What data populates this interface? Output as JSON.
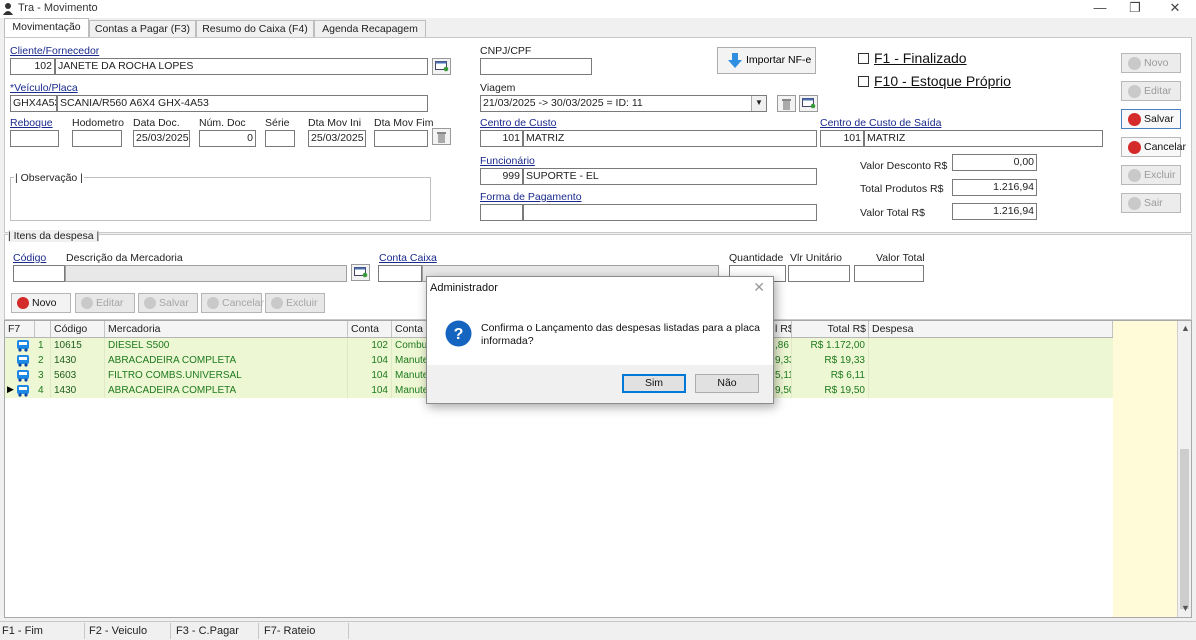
{
  "window": {
    "title": "Tra - Movimento",
    "controls": {
      "minimize": "—",
      "restore": "❐",
      "close": "✕"
    }
  },
  "tabs": [
    {
      "label": "Movimentação",
      "active": true
    },
    {
      "label": "Contas a Pagar (F3)"
    },
    {
      "label": "Resumo do Caixa (F4)"
    },
    {
      "label": "Agenda Recapagem"
    }
  ],
  "form": {
    "cliente_label": "Cliente/Fornecedor",
    "cliente_code": "102",
    "cliente_name": "JANETE DA ROCHA LOPES",
    "cnpj_label": "CNPJ/CPF",
    "cnpj_value": "",
    "import_button": "Importar NF-e",
    "veiculo_label": "*Veículo/Placa",
    "veiculo_placa": "GHX4A53",
    "veiculo_desc": "SCANIA/R560 A6X4 GHX-4A53",
    "viagem_label": "Viagem",
    "viagem_value": "21/03/2025 -> 30/03/2025 = ID: 11",
    "reboque_label": "Reboque",
    "hodometro_label": "Hodometro",
    "dtadoc_label": "Data Doc.",
    "dtadoc_value": "25/03/2025",
    "numdoc_label": "Núm. Doc",
    "numdoc_value": "0",
    "serie_label": "Série",
    "dtamovini_label": "Dta Mov Ini",
    "dtamovini_value": "25/03/2025",
    "dtamovfim_label": "Dta Mov Fim",
    "centro_custo_label": "Centro de Custo",
    "centro_custo_code": "101",
    "centro_custo_name": "MATRIZ",
    "centro_saida_label": "Centro de Custo de Saída",
    "centro_saida_code": "101",
    "centro_saida_name": "MATRIZ",
    "observacao_label": "| Observação |",
    "funcionario_label": "Funcionário",
    "funcionario_code": "999",
    "funcionario_name": "SUPORTE - EL",
    "forma_pagamento_label": "Forma de Pagamento",
    "valor_desconto_label": "Valor Desconto R$",
    "valor_desconto_value": "0,00",
    "total_produtos_label": "Total Produtos R$",
    "total_produtos_value": "1.216,94",
    "valor_total_label": "Valor Total R$",
    "valor_total_value": "1.216,94",
    "f1_label": "F1 - Finalizado",
    "f10_label": "F10 - Estoque Próprio"
  },
  "side_buttons": {
    "novo": "Novo",
    "editar": "Editar",
    "salvar": "Salvar",
    "cancelar": "Cancelar",
    "excluir": "Excluir",
    "sair": "Sair"
  },
  "itens": {
    "group_label": "| Itens da despesa |",
    "codigo_label": "Código",
    "descricao_label": "Descrição da Mercadoria",
    "conta_caixa_label": "Conta Caixa",
    "quantidade_label": "Quantidade",
    "vlr_unitario_label": "Vlr Unitário",
    "valor_total_label": "Valor Total",
    "toolbar": {
      "novo": "Novo",
      "editar": "Editar",
      "salvar": "Salvar",
      "cancelar": "Cancelar",
      "excluir": "Excluir"
    }
  },
  "grid": {
    "columns": [
      "F7",
      "",
      "Código",
      "Mercadoria",
      "Conta",
      "Conta C",
      "",
      "l R$",
      "Total R$",
      "Despesa"
    ],
    "rows": [
      {
        "n": "1",
        "codigo": "10615",
        "mercadoria": "DIESEL S500",
        "conta": "102",
        "conta_c": "Combus",
        "vl": ",86",
        "total": "R$ 1.172,00"
      },
      {
        "n": "2",
        "codigo": "1430",
        "mercadoria": "ABRACADEIRA COMPLETA",
        "conta": "104",
        "conta_c": "Manuter",
        "vl": "9,33",
        "total": "R$ 19,33"
      },
      {
        "n": "3",
        "codigo": "5603",
        "mercadoria": "FILTRO COMBS.UNIVERSAL",
        "conta": "104",
        "conta_c": "Manuter",
        "vl": "5,11",
        "total": "R$ 6,11"
      },
      {
        "n": "4",
        "codigo": "1430",
        "mercadoria": "ABRACADEIRA COMPLETA",
        "conta": "104",
        "conta_c": "Manuter",
        "vl": "9,50",
        "total": "R$ 19,50"
      }
    ]
  },
  "status_bar": [
    "F1 - Fim",
    "F2 - Veiculo",
    "F3 - C.Pagar",
    "F7- Rateio"
  ],
  "dialog": {
    "title": "Administrador",
    "close": "✕",
    "message": "Confirma o Lançamento das despesas listadas para a placa informada?",
    "yes": "Sim",
    "no": "Não"
  },
  "colors": {
    "row_bg": "#eef7d4",
    "row_text": "#1d7a1d",
    "dialog_accent": "#0078d7",
    "question_icon": "#1565c0"
  }
}
